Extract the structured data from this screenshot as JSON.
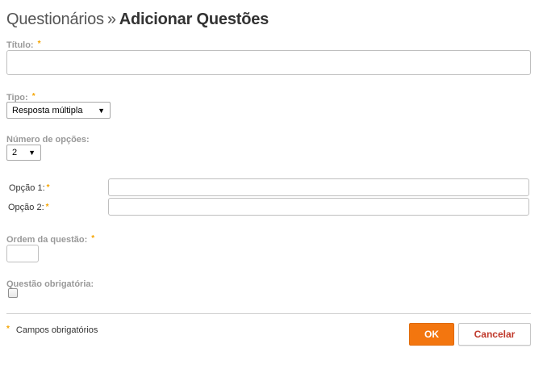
{
  "header": {
    "breadcrumb": "Questionários",
    "separator": "»",
    "current": "Adicionar Questões"
  },
  "required_marker": "*",
  "form": {
    "titulo_label": "Título:",
    "titulo_value": "",
    "tipo_label": "Tipo:",
    "tipo_selected": "Resposta múltipla",
    "num_opcoes_label": "Número de opções:",
    "num_opcoes_selected": "2",
    "opcao1_label": "Opção 1:",
    "opcao1_value": "",
    "opcao2_label": "Opção 2:",
    "opcao2_value": "",
    "ordem_label": "Ordem da questão:",
    "ordem_value": "",
    "obrigatoria_label": "Questão obrigatória:",
    "obrigatoria_checked": false
  },
  "footer": {
    "required_legend": "Campos obrigatórios",
    "ok_label": "OK",
    "cancel_label": "Cancelar"
  },
  "colors": {
    "accent": "#f3760f",
    "required": "#f5a400",
    "cancel_text": "#c0392b"
  }
}
